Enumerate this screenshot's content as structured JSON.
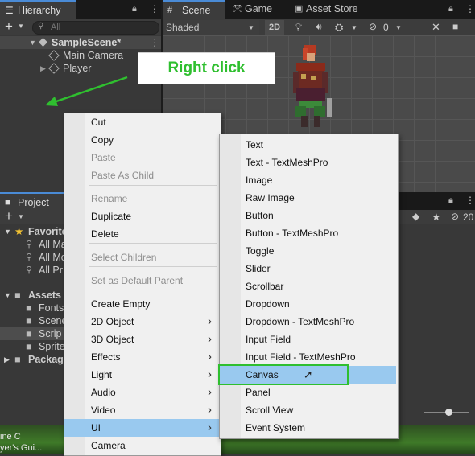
{
  "hierarchy": {
    "tab_label": "Hierarchy",
    "search_placeholder": "All",
    "scene_name": "SampleScene*",
    "items": [
      {
        "label": "Main Camera"
      },
      {
        "label": "Player"
      }
    ]
  },
  "scene_view": {
    "tabs": [
      {
        "label": "Scene"
      },
      {
        "label": "Game"
      },
      {
        "label": "Asset Store"
      }
    ],
    "shading_mode": "Shaded",
    "mode_2d_label": "2D",
    "hidden_count": "0"
  },
  "annotation": {
    "callout_text": "Right click",
    "color": "#2fbf2f"
  },
  "project": {
    "tab_label": "Project",
    "favorites_label": "Favorite",
    "favorite_items": [
      "All Ma",
      "All Mo",
      "All Pr"
    ],
    "assets_label": "Assets",
    "asset_folders": [
      "Fonts",
      "Scene",
      "Scrip",
      "Sprite"
    ],
    "packages_label": "Packag",
    "hidden_count": "20"
  },
  "game_view_footer": {
    "line1": "ine C",
    "line2": "yer's Gui..."
  },
  "context_menu": {
    "items": [
      {
        "label": "Cut",
        "enabled": true
      },
      {
        "label": "Copy",
        "enabled": true
      },
      {
        "label": "Paste",
        "enabled": false
      },
      {
        "label": "Paste As Child",
        "enabled": false
      },
      {
        "label": "Rename",
        "enabled": false
      },
      {
        "label": "Duplicate",
        "enabled": true
      },
      {
        "label": "Delete",
        "enabled": true
      },
      {
        "label": "Select Children",
        "enabled": false
      },
      {
        "label": "Set as Default Parent",
        "enabled": false
      },
      {
        "label": "Create Empty",
        "enabled": true
      },
      {
        "label": "2D Object",
        "enabled": true,
        "submenu": true
      },
      {
        "label": "3D Object",
        "enabled": true,
        "submenu": true
      },
      {
        "label": "Effects",
        "enabled": true,
        "submenu": true
      },
      {
        "label": "Light",
        "enabled": true,
        "submenu": true
      },
      {
        "label": "Audio",
        "enabled": true,
        "submenu": true
      },
      {
        "label": "Video",
        "enabled": true,
        "submenu": true
      },
      {
        "label": "UI",
        "enabled": true,
        "submenu": true,
        "highlighted": true
      },
      {
        "label": "Camera",
        "enabled": true
      }
    ]
  },
  "ui_submenu": {
    "items": [
      {
        "label": "Text"
      },
      {
        "label": "Text - TextMeshPro"
      },
      {
        "label": "Image"
      },
      {
        "label": "Raw Image"
      },
      {
        "label": "Button"
      },
      {
        "label": "Button - TextMeshPro"
      },
      {
        "label": "Toggle"
      },
      {
        "label": "Slider"
      },
      {
        "label": "Scrollbar"
      },
      {
        "label": "Dropdown"
      },
      {
        "label": "Dropdown - TextMeshPro"
      },
      {
        "label": "Input Field"
      },
      {
        "label": "Input Field - TextMeshPro"
      },
      {
        "label": "Canvas",
        "highlighted": true
      },
      {
        "label": "Panel"
      },
      {
        "label": "Scroll View"
      },
      {
        "label": "Event System"
      }
    ]
  },
  "colors": {
    "menu_highlight": "#99c9ef",
    "annotation_green": "#2fbf2f",
    "editor_bg": "#383838"
  }
}
